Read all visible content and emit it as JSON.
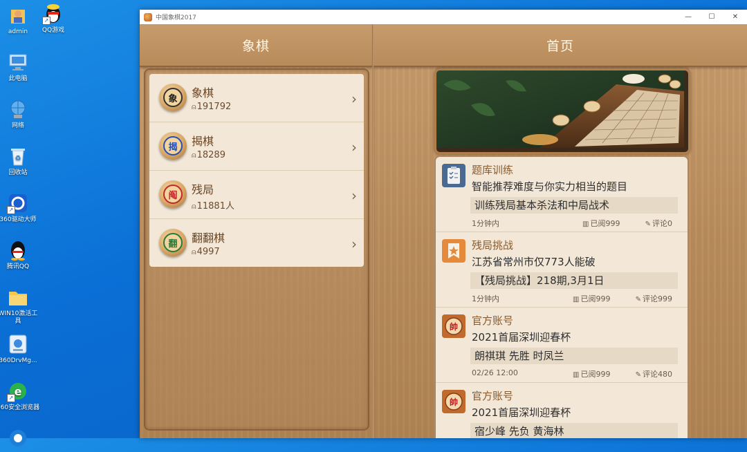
{
  "desktop": {
    "icons": [
      {
        "label": "admin",
        "icon": "user-folder-icon"
      },
      {
        "label": "QQ游戏",
        "icon": "qq-game-icon"
      },
      {
        "label": "此电脑",
        "icon": "computer-icon"
      },
      {
        "label": "网络",
        "icon": "network-icon"
      },
      {
        "label": "回收站",
        "icon": "recycle-bin-icon"
      },
      {
        "label": "360驱动大师",
        "icon": "driver-master-icon"
      },
      {
        "label": "腾讯QQ",
        "icon": "qq-penguin-icon"
      },
      {
        "label": "WIN10激活工具",
        "icon": "folder-icon"
      },
      {
        "label": "360DrvMg...",
        "icon": "drv-manager-icon"
      },
      {
        "label": "360安全浏览器",
        "icon": "browser-icon"
      }
    ]
  },
  "window": {
    "title": "中国象棋2017",
    "controls": {
      "minimize": "—",
      "maximize": "☐",
      "close": "✕"
    }
  },
  "left_pane": {
    "header": "象棋",
    "games": [
      {
        "name": "象棋",
        "count": "191792",
        "piece_char": "象",
        "piece_color": "#222222"
      },
      {
        "name": "揭棋",
        "count": "18289",
        "piece_char": "揭",
        "piece_color": "#2a4fb0"
      },
      {
        "name": "残局",
        "count": "11881人",
        "piece_char": "阄",
        "piece_color": "#c0282a"
      },
      {
        "name": "翻翻棋",
        "count": "4997",
        "piece_char": "翻",
        "piece_color": "#287a3a"
      }
    ]
  },
  "right_pane": {
    "header": "首页",
    "feed": [
      {
        "icon": "quiz-clipboard-icon",
        "title": "题库训练",
        "subtitle": "智能推荐难度与你实力相当的题目",
        "quote": "训练残局基本杀法和中局战术",
        "time": "1分钟内",
        "read": "已阅999",
        "comment": "评论0"
      },
      {
        "icon": "endgame-star-icon",
        "title": "残局挑战",
        "subtitle": "江苏省常州市仅773人能破",
        "quote": "【残局挑战】218期,3月1日",
        "time": "1分钟内",
        "read": "已阅999",
        "comment": "评论999"
      },
      {
        "icon": "official-shuai-icon",
        "title": "官方账号",
        "subtitle": "2021首届深圳迎春杯",
        "quote": "朗祺琪 先胜 时凤兰",
        "time": "02/26 12:00",
        "read": "已阅999",
        "comment": "评论480"
      },
      {
        "icon": "official-shuai-icon",
        "title": "官方账号",
        "subtitle": "2021首届深圳迎春杯",
        "quote": "宿少峰 先负 黄海林",
        "time": "",
        "read": "",
        "comment": ""
      }
    ]
  },
  "colors": {
    "wood": "#c29566",
    "panel": "#f3e8d8",
    "title_brown": "#8a5a2b",
    "desktop_blue": "#0a6fd6"
  }
}
